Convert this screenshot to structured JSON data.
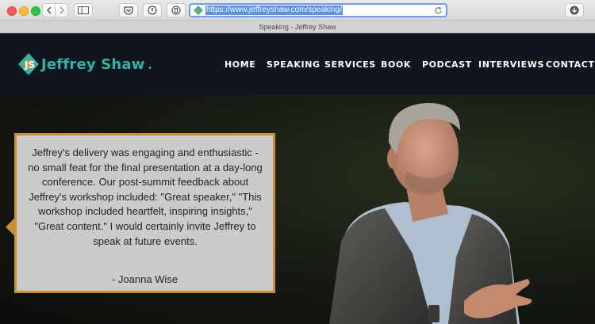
{
  "browser": {
    "url": "https://www.jeffreyshaw.com/speaking/",
    "tab_title": "Speaking - Jeffrey Shaw"
  },
  "site": {
    "logo_text": "Jeffrey Shaw",
    "logo_dot": ".",
    "brand_color": "#2fb3ad",
    "accent_color": "#c8902e",
    "nav": [
      {
        "label": "HOME"
      },
      {
        "label": "SPEAKING"
      },
      {
        "label": "SERVICES"
      },
      {
        "label": "BOOK"
      },
      {
        "label": "PODCAST"
      },
      {
        "label": "INTERVIEWS"
      },
      {
        "label": "CONTACT"
      }
    ]
  },
  "testimonial": {
    "quote": "Jeffrey's delivery was engaging and enthusiastic - no small feat for the final presentation at a day-long conference. Our post-summit feedback about Jeffrey's workshop included: \"Great speaker,\" \"This workshop included heartfelt, inspiring insights,\" \"Great content.\" I would certainly invite Jeffrey to speak at future events.",
    "author": "- Joanna Wise"
  },
  "icons": {
    "back": "chevron-left-icon",
    "forward": "chevron-right-icon",
    "sidebar": "sidebar-icon",
    "pocket": "pocket-icon",
    "reload": "reload-icon",
    "download": "download-icon"
  }
}
